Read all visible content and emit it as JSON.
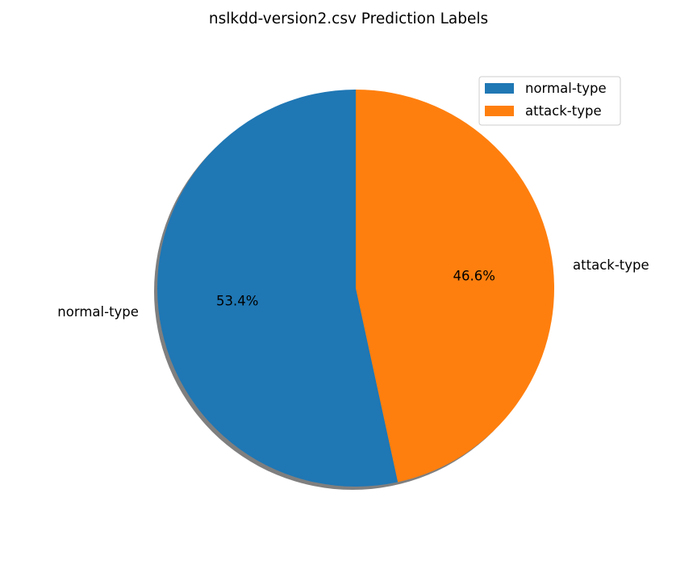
{
  "chart_data": {
    "type": "pie",
    "title": "nslkdd-version2.csv Prediction Labels",
    "slices": [
      {
        "label": "normal-type",
        "value": 53.4,
        "pct_text": "53.4%",
        "color": "#1f77b4"
      },
      {
        "label": "attack-type",
        "value": 46.6,
        "pct_text": "46.6%",
        "color": "#ff7f0e"
      }
    ],
    "start_angle_deg": 90,
    "direction": "counterclockwise",
    "shadow": true,
    "legend": {
      "position": "top-right",
      "entries": [
        "normal-type",
        "attack-type"
      ]
    }
  }
}
